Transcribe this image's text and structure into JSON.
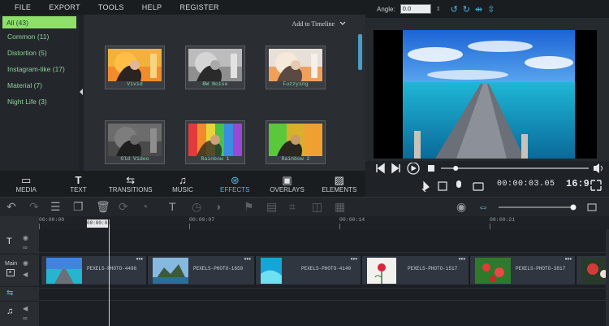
{
  "menu": [
    "FILE",
    "EXPORT",
    "TOOLS",
    "HELP",
    "REGISTER"
  ],
  "categories": [
    {
      "label": "All (43)",
      "selected": true
    },
    {
      "label": "Common (11)"
    },
    {
      "label": "Distortion (5)"
    },
    {
      "label": "Instagram-like (17)"
    },
    {
      "label": "Material (7)"
    },
    {
      "label": "Night Life (3)"
    }
  ],
  "gallery": {
    "add_to_timeline": "Add to Timeline",
    "effects": [
      "Vivid",
      "BW Noise",
      "Fuzzying",
      "Old Video",
      "Rainbow 1",
      "Rainbow 2"
    ]
  },
  "tabs": [
    {
      "label": "MEDIA",
      "icon": "film-icon"
    },
    {
      "label": "TEXT",
      "icon": "text-icon"
    },
    {
      "label": "TRANSITIONS",
      "icon": "transition-icon"
    },
    {
      "label": "MUSIC",
      "icon": "music-icon"
    },
    {
      "label": "EFFECTS",
      "icon": "effects-icon",
      "active": true
    },
    {
      "label": "OVERLAYS",
      "icon": "overlay-icon"
    },
    {
      "label": "ELEMENTS",
      "icon": "image-icon"
    }
  ],
  "preview": {
    "angle_label": "Angle:",
    "angle_value": "0.0",
    "timecode": "00:00:03.05",
    "aspect": "16:9",
    "progress": 0.1
  },
  "timeline": {
    "ticks": [
      "00:00:00",
      "00:00:07",
      "00:00:14",
      "00:00:21"
    ],
    "playhead_time": "00:00:02",
    "main_track_label": "Main",
    "clips": [
      "PEXELS-PHOTO-4496",
      "PEXELS-PHOTO-1659",
      "PEXELS-PHOTO-4140",
      "PEXELS-PHOTO-1517",
      "PEXELS-PHOTO-3817"
    ]
  },
  "colors": {
    "accent": "#4db6e8",
    "category_selected": "#8ee06a",
    "category_text": "#8fd19a"
  }
}
